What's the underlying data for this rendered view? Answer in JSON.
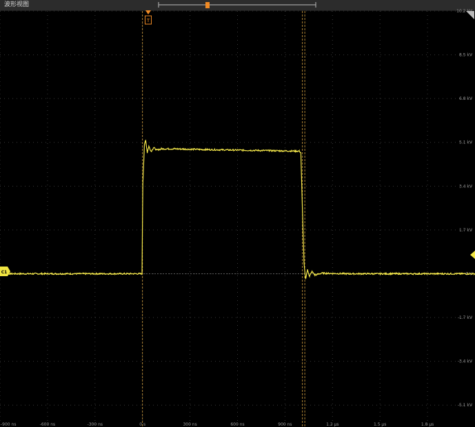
{
  "window": {
    "title": "波形视图"
  },
  "channel": {
    "label": "C1",
    "color": "#f0e442"
  },
  "trigger": {
    "label": "T",
    "color": "#f08a24"
  },
  "colors": {
    "grid": "#3a3a3a",
    "trace": "#f5e84a",
    "cursor": "#d9a441",
    "background": "#000000"
  },
  "icons": {
    "corner": "corner-fold-icon",
    "ref_arrow": "right-level-arrow-icon"
  },
  "chart_data": {
    "type": "line",
    "xlabel": "",
    "ylabel": "",
    "x_unit": "ns",
    "y_unit": "kV",
    "xlim": [
      -900,
      2100
    ],
    "ylim": [
      -5.95,
      10.2
    ],
    "grid": true,
    "x_tick_labels": [
      "-900 ns",
      "-600 ns",
      "-300 ns",
      "0 s",
      "300 ns",
      "600 ns",
      "900 ns",
      "1.2 µs",
      "1.5 µs",
      "1.8 µs"
    ],
    "x_tick_values": [
      -900,
      -600,
      -300,
      0,
      300,
      600,
      900,
      1200,
      1500,
      1800
    ],
    "y_tick_labels": [
      "10.2 kV",
      "8.5 kV",
      "6.8 kV",
      "5.1 kV",
      "3.4 kV",
      "1.7 kV",
      "0 V",
      "-1.7 kV",
      "-3.4 kV",
      "-5.1 kV"
    ],
    "y_tick_values": [
      10.2,
      8.5,
      6.8,
      5.1,
      3.4,
      1.7,
      0,
      -1.7,
      -3.4,
      -5.1
    ],
    "cursors_x": [
      0,
      1010,
      1025
    ],
    "series": [
      {
        "x": [
          -900,
          -3,
          2,
          12,
          20,
          30,
          40,
          55,
          70,
          90,
          120,
          200,
          400,
          600,
          800,
          990,
          1000,
          1010,
          1020,
          1030,
          1042,
          1055,
          1070,
          1090,
          1130,
          1300,
          1600,
          2100
        ],
        "y": [
          0,
          0,
          3.5,
          5.0,
          5.2,
          4.7,
          4.95,
          4.75,
          4.9,
          4.8,
          4.85,
          4.85,
          4.82,
          4.8,
          4.78,
          4.76,
          4.7,
          2.5,
          0.4,
          -0.2,
          0.15,
          -0.1,
          0.08,
          -0.05,
          0.02,
          0,
          0,
          0
        ]
      }
    ]
  }
}
